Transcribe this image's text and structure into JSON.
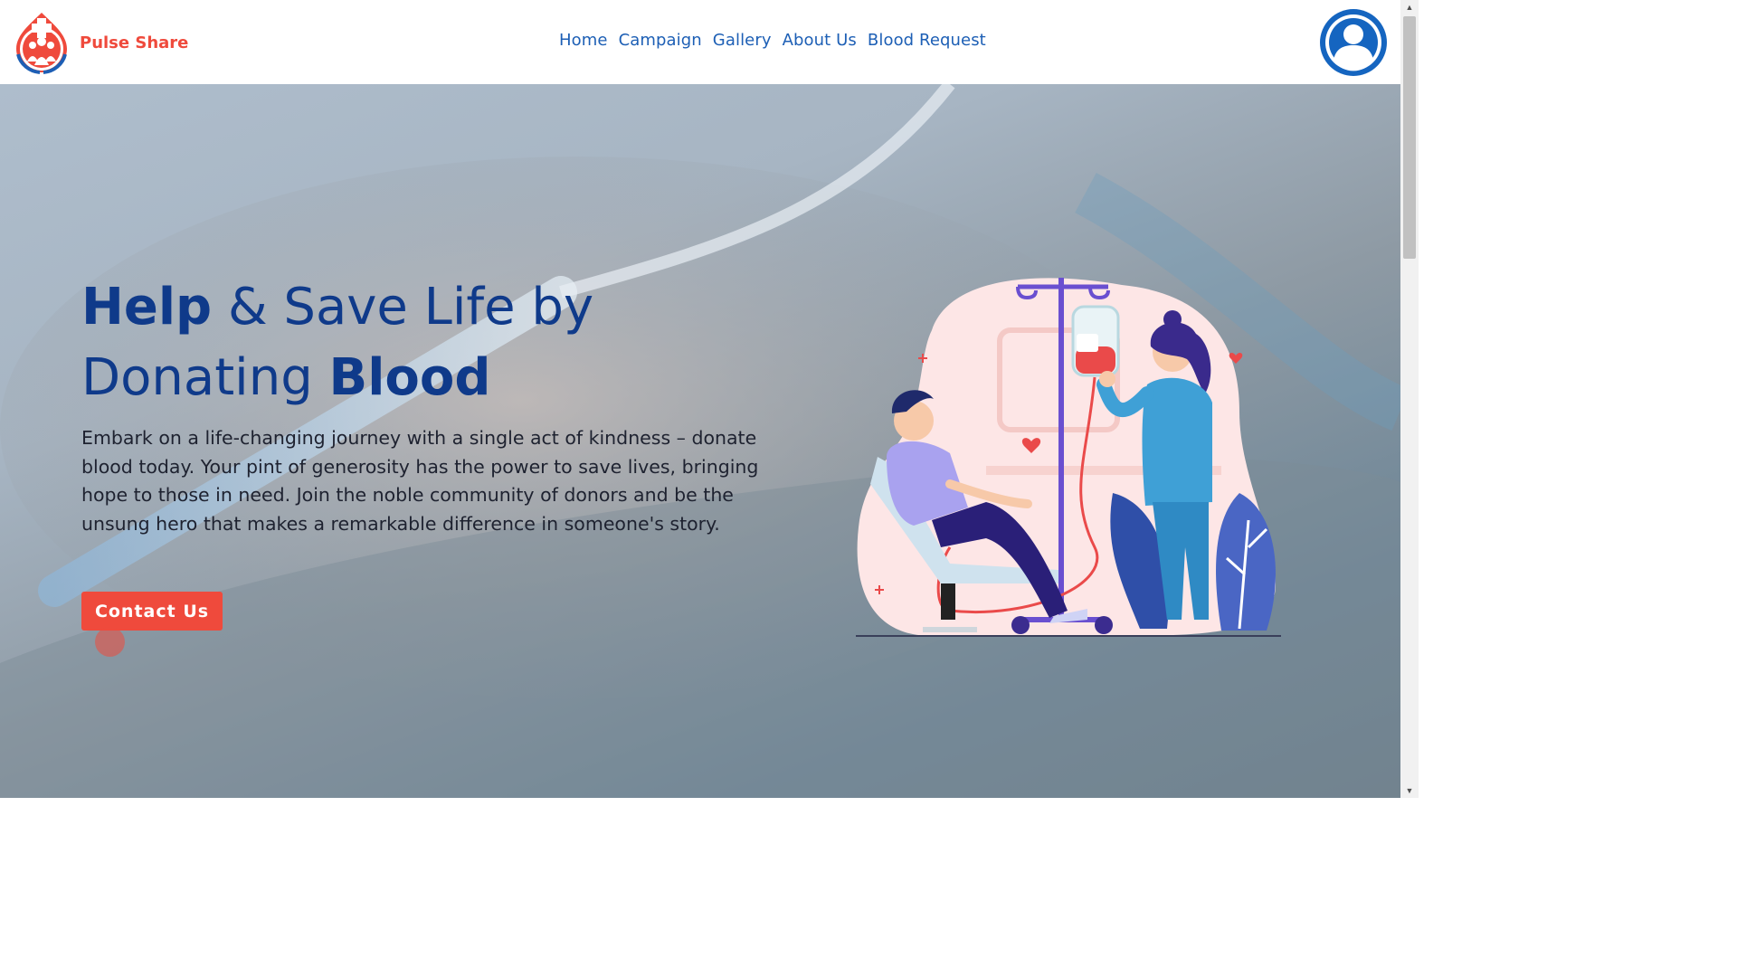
{
  "header": {
    "brand": "Pulse Share",
    "nav": [
      "Home",
      "Campaign",
      "Gallery",
      "About Us",
      "Blood Request"
    ]
  },
  "hero": {
    "title_bold_1": "Help",
    "title_rest_1": " & Save Life by",
    "title_rest_2": "Donating ",
    "title_bold_2": "Blood",
    "description": "Embark on a life-changing journey with a single act of kindness – donate blood today. Your pint of generosity has the power to save lives, bringing hope to those in need. Join the noble community of donors and be the unsung hero that makes a remarkable difference in someone's story.",
    "button_label": "Contact Us"
  },
  "icons": {
    "logo": "pulse-share-logo",
    "avatar": "user-avatar-icon",
    "illustration": "blood-donation-illustration"
  },
  "colors": {
    "brand_red": "#ef4a3c",
    "nav_blue": "#1d5fb5",
    "title_navy": "#0f3a8a"
  }
}
